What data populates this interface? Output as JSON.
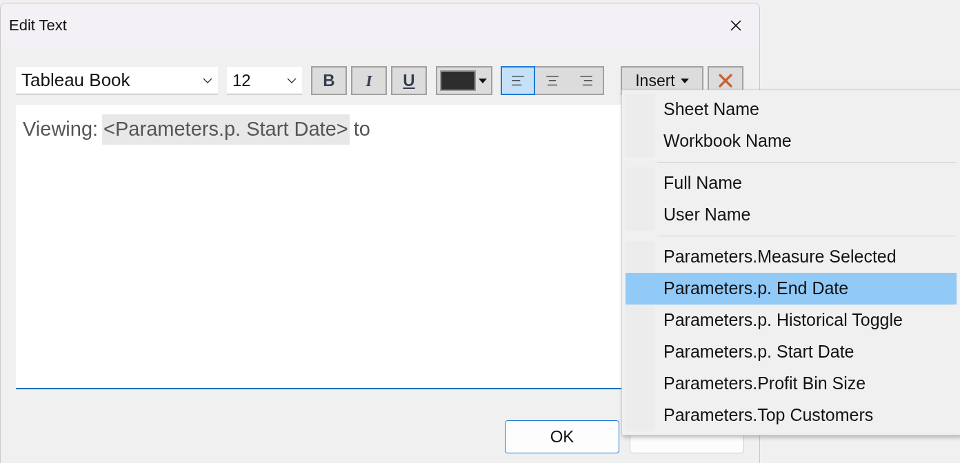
{
  "window": {
    "title": "Edit Text"
  },
  "toolbar": {
    "font": "Tableau Book",
    "size": "12",
    "bold": "B",
    "italic": "I",
    "underline": "U",
    "insert": "Insert",
    "align": [
      {
        "kind": "left",
        "selected": true
      },
      {
        "kind": "center",
        "selected": false
      },
      {
        "kind": "right",
        "selected": false
      }
    ]
  },
  "editor": {
    "text_before": "Viewing:",
    "field": "<Parameters.p. Start Date>",
    "text_after": "to"
  },
  "insert_menu": {
    "groups": [
      [
        {
          "label": "Sheet Name",
          "selected": false
        },
        {
          "label": "Workbook Name",
          "selected": false
        }
      ],
      [
        {
          "label": "Full Name",
          "selected": false
        },
        {
          "label": "User Name",
          "selected": false
        }
      ],
      [
        {
          "label": "Parameters.Measure Selected",
          "selected": false
        },
        {
          "label": "Parameters.p. End Date",
          "selected": true
        },
        {
          "label": "Parameters.p. Historical Toggle",
          "selected": false
        },
        {
          "label": "Parameters.p. Start Date",
          "selected": false
        },
        {
          "label": "Parameters.Profit Bin Size",
          "selected": false
        },
        {
          "label": "Parameters.Top Customers",
          "selected": false
        }
      ]
    ]
  },
  "buttons": {
    "ok": "OK"
  }
}
